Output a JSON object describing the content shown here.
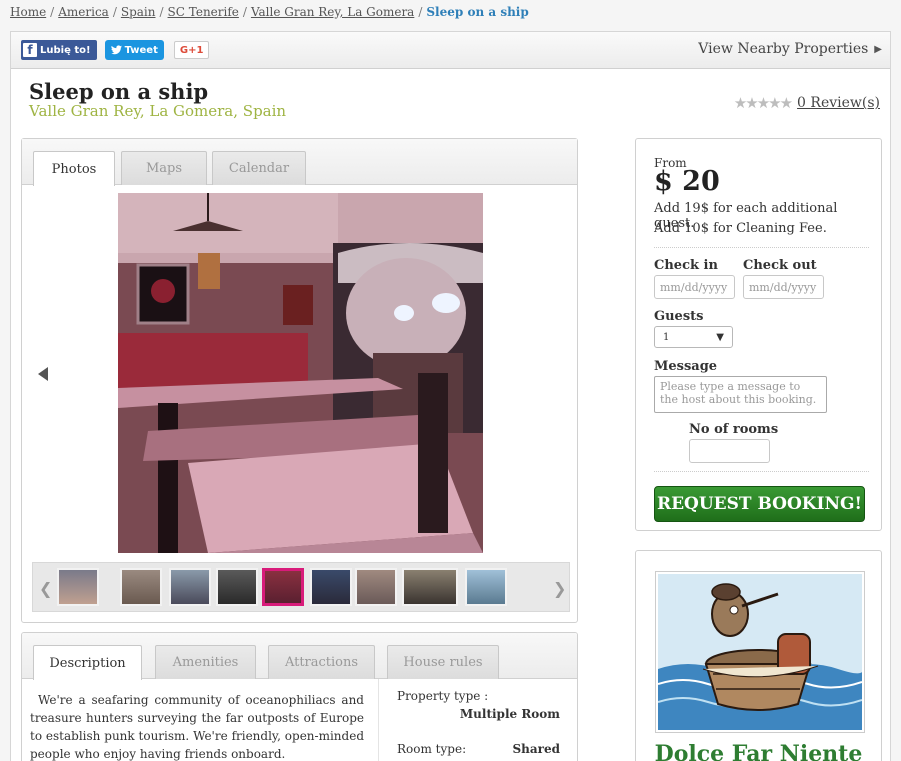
{
  "breadcrumb": {
    "items": [
      "Home",
      "America",
      "Spain",
      "SC Tenerife",
      "Valle Gran Rey, La Gomera"
    ],
    "separator": "/",
    "current": "Sleep on a ship"
  },
  "social": {
    "facebook": "Lubię to!",
    "twitter": "Tweet",
    "gplus": "G+1"
  },
  "nearby": {
    "label": "View Nearby Properties",
    "icon": "triangle-right-icon"
  },
  "property": {
    "title": "Sleep on a ship",
    "location": "Valle Gran Rey, La Gomera, Spain",
    "rating_stars": "★★★★★",
    "rating_value": 0,
    "reviews_link": "0 Review(s)"
  },
  "gallery_tabs": [
    "Photos",
    "Maps",
    "Calendar"
  ],
  "thumbnail_count": 10,
  "selected_thumbnail": 5,
  "info_tabs": [
    "Description",
    "Amenities",
    "Attractions",
    "House rules"
  ],
  "description": "We're a seafaring community of oceanophiliacs and treasure hunters surveying the far outposts of Europe to establish punk tourism. We're friendly, open-minded people who enjoy having friends onboard.",
  "properties": {
    "type_label": "Property type :",
    "type_value": "Multiple Room",
    "room_label": "Room type:",
    "room_value": "Shared"
  },
  "booking": {
    "from_label": "From",
    "price": "$ 20",
    "extra_guest_note": "Add 19$ for each additional guest.",
    "cleaning_note": "Add 10$ for Cleaning Fee.",
    "checkin_label": "Check in",
    "checkin_placeholder": "mm/dd/yyyy",
    "checkout_label": "Check out",
    "checkout_placeholder": "mm/dd/yyyy",
    "guests_label": "Guests",
    "guests_value": "1",
    "message_label": "Message",
    "message_placeholder": "Please type a message to the host about this booking.",
    "rooms_label": "No of rooms",
    "rooms_value": "",
    "submit_label": "REQUEST BOOKING!"
  },
  "ad": {
    "title": "Dolce Far Niente",
    "image_caption": "Dolce Far Niente"
  },
  "colors": {
    "link_current": "#2e7fb8",
    "location": "#9fb443",
    "book_button": "#2b8a25",
    "thumb_selected": "#d81b7a",
    "ad_title": "#2e7d32"
  }
}
